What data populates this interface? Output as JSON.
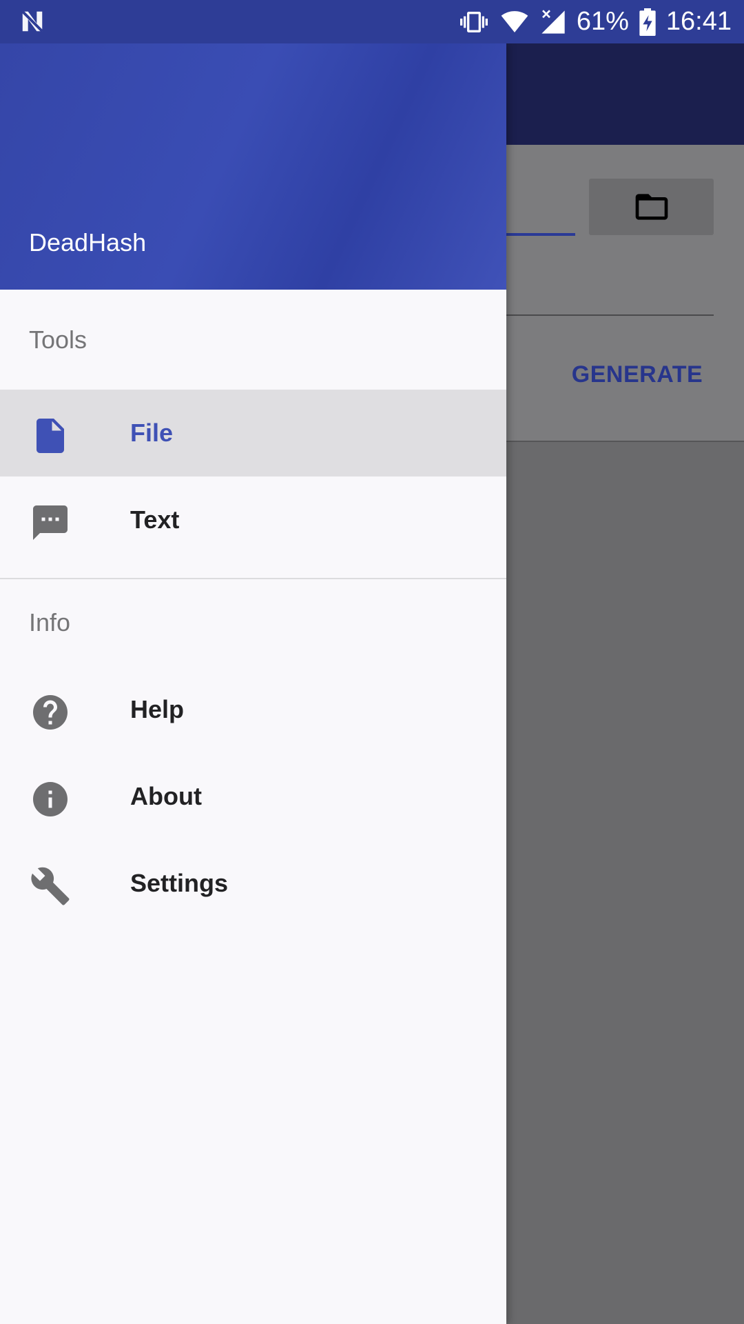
{
  "status_bar": {
    "battery": "61%",
    "time": "16:41",
    "icons": [
      "notification-n-icon",
      "vibrate-icon",
      "wifi-icon",
      "cell-signal-icon",
      "battery-charging-icon"
    ]
  },
  "drawer": {
    "app_name": "DeadHash",
    "sections": [
      {
        "title": "Tools",
        "items": [
          {
            "label": "File",
            "icon": "file-icon",
            "active": true
          },
          {
            "label": "Text",
            "icon": "message-icon",
            "active": false
          }
        ]
      },
      {
        "title": "Info",
        "items": [
          {
            "label": "Help",
            "icon": "help-icon",
            "active": false
          },
          {
            "label": "About",
            "icon": "info-icon",
            "active": false
          },
          {
            "label": "Settings",
            "icon": "wrench-icon",
            "active": false
          }
        ]
      }
    ]
  },
  "background_app": {
    "generate_label": "GENERATE",
    "browse_icon": "folder-icon"
  },
  "colors": {
    "primary": "#3f51b5",
    "status_bar": "#2e3d96",
    "active_item_bg": "#dfdee1"
  }
}
